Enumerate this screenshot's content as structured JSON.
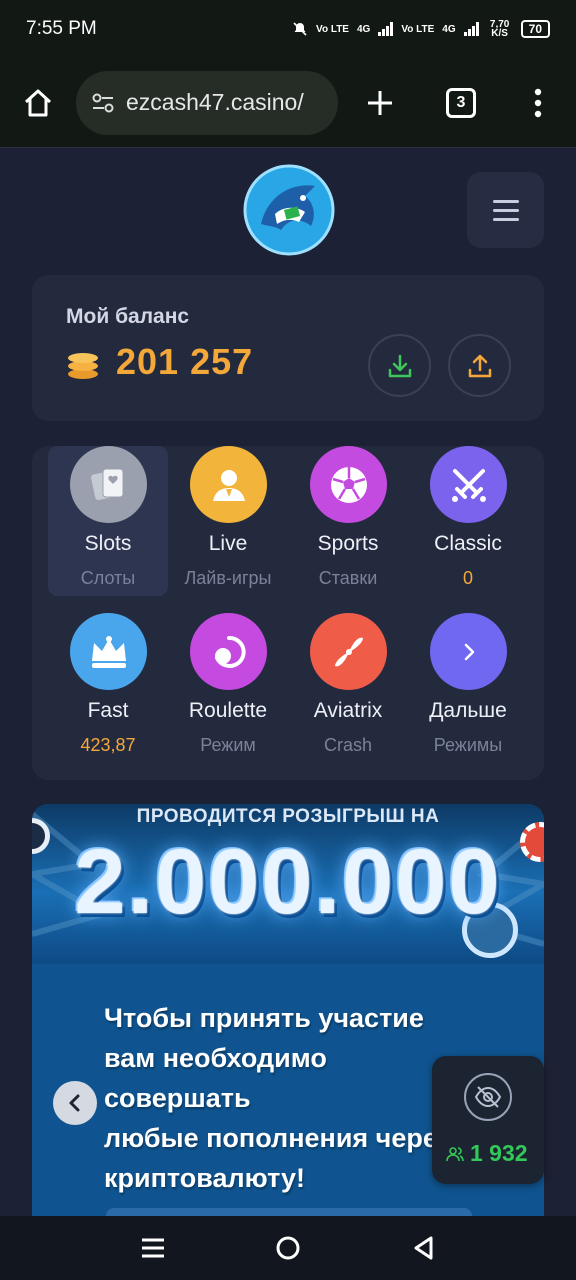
{
  "status_bar": {
    "time": "7:55 PM",
    "network_1": "Vo LTE",
    "net_type_1": "4G",
    "network_2": "Vo LTE",
    "net_type_2": "4G",
    "speed": "7,70 K/S",
    "battery": "70"
  },
  "browser": {
    "url": "ezcash47.casino/",
    "tab_count": "3"
  },
  "balance": {
    "label": "Мой баланс",
    "value": "201 257"
  },
  "games": [
    {
      "title": "Slots",
      "sub": "Слоты",
      "color": "#9aa0ad",
      "icon": "cards-icon"
    },
    {
      "title": "Live",
      "sub": "Лайв-игры",
      "color": "#f2b43a",
      "icon": "dealer-icon"
    },
    {
      "title": "Sports",
      "sub": "Ставки",
      "color": "#c44be0",
      "icon": "soccer-ball-icon"
    },
    {
      "title": "Classic",
      "sub": "0",
      "color": "#7c63ee",
      "icon": "crossed-swords-icon"
    },
    {
      "title": "Fast",
      "sub": "423,87",
      "color": "#4aa6ec",
      "icon": "crown-icon"
    },
    {
      "title": "Roulette",
      "sub": "Режим",
      "color": "#c54ae0",
      "icon": "roulette-icon"
    },
    {
      "title": "Aviatrix",
      "sub": "Crash",
      "color": "#ef5c48",
      "icon": "propeller-icon"
    },
    {
      "title": "Дальше",
      "sub": "Режимы",
      "color": "#7068f0",
      "icon": "chevron-right-icon"
    }
  ],
  "banner": {
    "kicker": "ПРОВОДИТСЯ РОЗЫГРЫШ НА",
    "amount": "2.000.000",
    "lines": [
      "Чтобы принять участие",
      "вам необходимо",
      "совершать",
      "любые пополнения через",
      "криптовалюту!"
    ]
  },
  "online": {
    "count": "1 932"
  }
}
